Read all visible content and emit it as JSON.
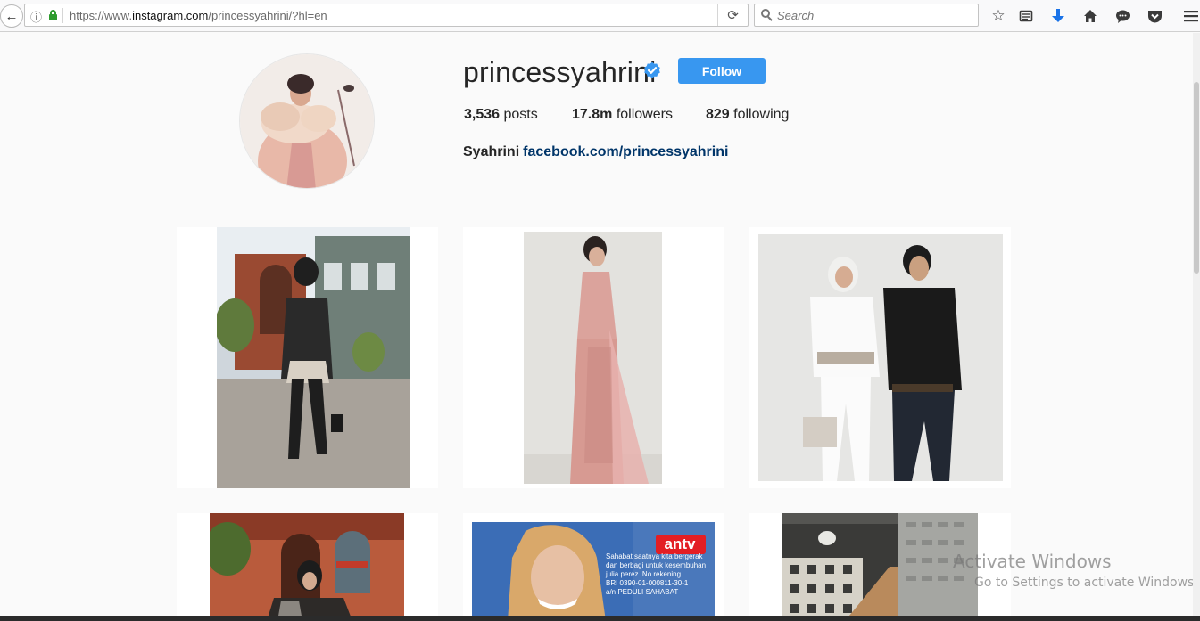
{
  "browser": {
    "url_prefix": "https://www.",
    "url_host": "instagram.com",
    "url_path": "/princessyahrini/?hl=en",
    "search_placeholder": "Search"
  },
  "profile": {
    "username": "princessyahrini",
    "verified": true,
    "follow_label": "Follow",
    "stats": {
      "posts_count": "3,536",
      "posts_label": "posts",
      "followers_count": "17.8m",
      "followers_label": "followers",
      "following_count": "829",
      "following_label": "following"
    },
    "bio_name": "Syahrini",
    "bio_link": "facebook.com/princessyahrini"
  },
  "posts": [
    {
      "id": 1,
      "alt": "woman in black hijab and leather jacket walking on street"
    },
    {
      "id": 2,
      "alt": "woman in pink lace gown"
    },
    {
      "id": 3,
      "alt": "woman in white hijab with man in black shirt"
    },
    {
      "id": 4,
      "alt": "woman in black hijab on phone"
    },
    {
      "id": 5,
      "alt": "antv promotional poster"
    },
    {
      "id": 6,
      "alt": "interior stairs with patterned wall"
    }
  ],
  "post5_text": {
    "brand": "antv",
    "lines": [
      "Sahabat saatnya kita bergerak",
      "dan berbagi untuk kesembuhan",
      "julia perez. No rekening",
      "BRI 0390-01-000811-30-1",
      "a/n PEDULI SAHABAT"
    ]
  },
  "watermark": {
    "title": "Activate Windows",
    "subtitle": "Go to Settings to activate Windows."
  },
  "colors": {
    "follow_button": "#3897f0",
    "verified_badge": "#3897f0",
    "link": "#003569"
  }
}
